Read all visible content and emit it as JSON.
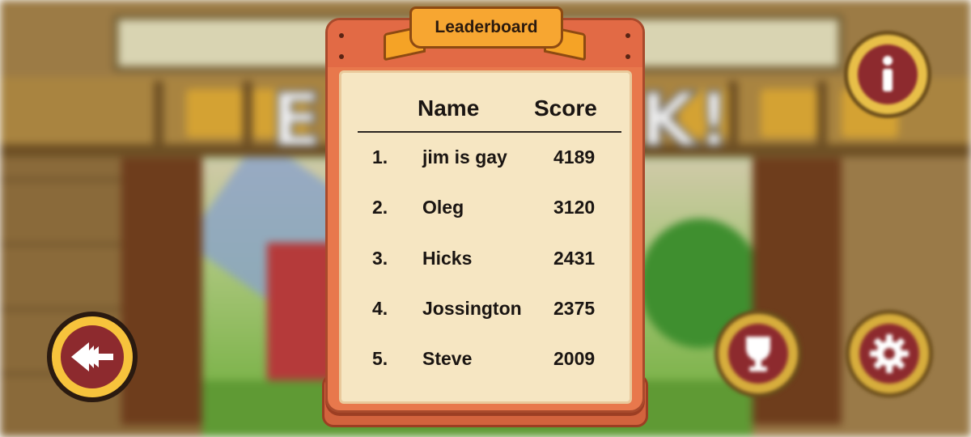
{
  "game": {
    "title_partial": "E                K!"
  },
  "leaderboard": {
    "title": "Leaderboard",
    "columns": {
      "name": "Name",
      "score": "Score"
    },
    "rows": [
      {
        "rank": "1.",
        "name": "jim is gay",
        "score": "4189"
      },
      {
        "rank": "2.",
        "name": "Oleg",
        "score": "3120"
      },
      {
        "rank": "3.",
        "name": "Hicks",
        "score": "2431"
      },
      {
        "rank": "4.",
        "name": "Jossington",
        "score": "2375"
      },
      {
        "rank": "5.",
        "name": "Steve",
        "score": "2009"
      }
    ]
  },
  "buttons": {
    "back_icon": "back-arrow-icon",
    "info_icon": "info-icon",
    "trophy_icon": "trophy-icon",
    "settings_icon": "gear-icon"
  },
  "colors": {
    "panel_orange": "#e8784c",
    "paper": "#f6e6c2",
    "ribbon": "#f7a631",
    "button_gold": "#f7c33c",
    "button_maroon": "#8d2a2e"
  }
}
